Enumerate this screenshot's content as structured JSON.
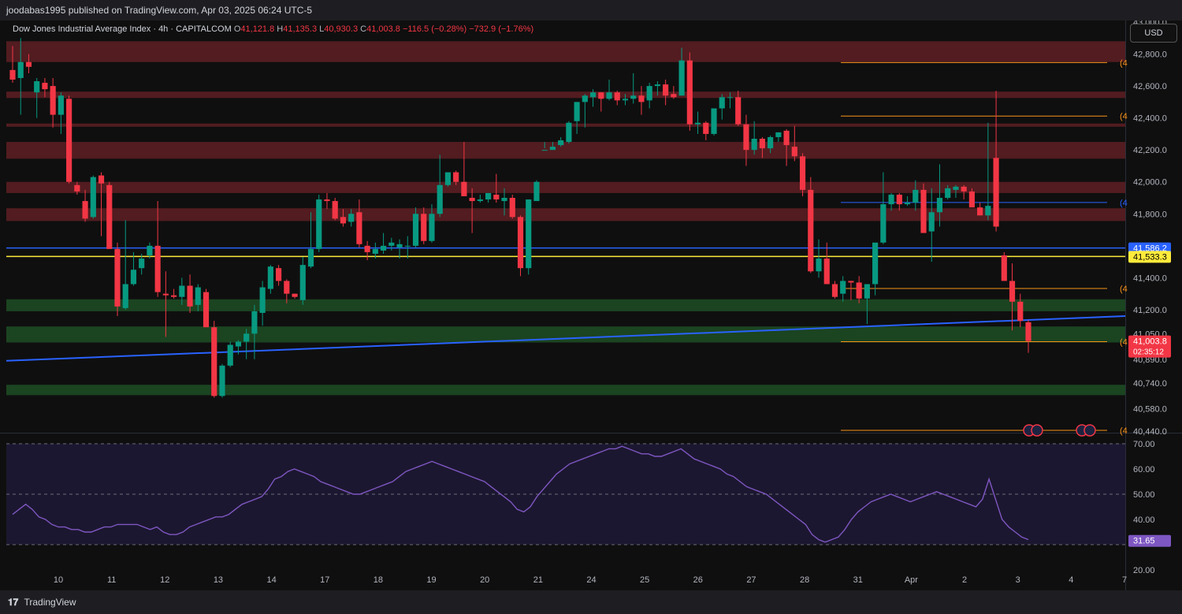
{
  "header": {
    "publisher_text": "joodabas1995 published on TradingView.com, Apr 03, 2025 06:24 UTC-5"
  },
  "footer": {
    "brand": "TradingView"
  },
  "legend": {
    "symbol": "Dow Jones Industrial Average Index · 4h · CAPITALCOM",
    "open_label": "O",
    "open": "41,121.8",
    "high_label": "H",
    "high": "41,135.3",
    "low_label": "L",
    "low": "40,930.3",
    "close_label": "C",
    "close": "41,003.8",
    "change": "−116.5 (−0.28%)",
    "change2": "−732.9 (−1.76%)"
  },
  "currency_button": "USD",
  "colors": {
    "up": "#089981",
    "down": "#f23645",
    "resistance_zone": "#5a1e22",
    "support_zone": "#1d4a24",
    "trendline": "#2962ff",
    "yellow_line": "#ffeb3b",
    "orange_line": "#f7931a",
    "rsi": "#7e57c2"
  },
  "chart_data": [
    {
      "type": "candlestick",
      "title": "Dow Jones Industrial Average Index · 4h · CAPITALCOM",
      "x_tick_labels": [
        "10",
        "11",
        "12",
        "13",
        "14",
        "17",
        "18",
        "19",
        "20",
        "21",
        "24",
        "25",
        "26",
        "27",
        "28",
        "31",
        "Apr",
        "2",
        "3",
        "4",
        "7"
      ],
      "y_tick_labels": [
        "43,000.0",
        "42,800.0",
        "42,600.0",
        "42,400.0",
        "42,200.0",
        "42,000.0",
        "41,800.0",
        "41,400.0",
        "41,200.0",
        "41,050.0",
        "40,890.0",
        "40,740.0",
        "40,580.0",
        "40,440.0"
      ],
      "ylim": [
        40430,
        43010
      ],
      "price_labels": [
        {
          "text": "41,586.2",
          "value": 41586.2,
          "color": "#2962ff"
        },
        {
          "text": "41,533.3",
          "value": 41533.3,
          "color": "#ffeb3b"
        },
        {
          "text": "41,003.8",
          "value": 41003.8,
          "color": "#f23645",
          "countdown": "02:35:12"
        }
      ],
      "horizontal_lines": [
        {
          "value": 41586.2,
          "color": "#2962ff"
        },
        {
          "value": 41533.3,
          "color": "#ffeb3b"
        },
        {
          "value": 42747,
          "color": "#f7931a",
          "label": "(4"
        },
        {
          "value": 42412,
          "color": "#f7931a",
          "label": "(4"
        },
        {
          "value": 41871,
          "color": "#2962ff",
          "label": "(4"
        },
        {
          "value": 41333,
          "color": "#f7931a",
          "label": "(4"
        },
        {
          "value": 41000,
          "color": "#f7931a",
          "label": "(4"
        },
        {
          "value": 40445,
          "color": "#f7931a",
          "label": "(4"
        }
      ],
      "zones": [
        {
          "type": "resistance",
          "from": 42750,
          "to": 42880
        },
        {
          "type": "resistance",
          "from": 42525,
          "to": 42565
        },
        {
          "type": "resistance",
          "from": 42345,
          "to": 42365
        },
        {
          "type": "resistance",
          "from": 42145,
          "to": 42250
        },
        {
          "type": "resistance",
          "from": 41930,
          "to": 42000
        },
        {
          "type": "resistance",
          "from": 41755,
          "to": 41835
        },
        {
          "type": "support",
          "from": 41190,
          "to": 41265
        },
        {
          "type": "support",
          "from": 40995,
          "to": 41095
        },
        {
          "type": "support",
          "from": 40665,
          "to": 40730
        }
      ],
      "trendline": {
        "start": 40880,
        "end": 41160
      },
      "candles": [
        [
          42700,
          42850,
          42620,
          42640
        ],
        [
          42650,
          42900,
          42420,
          42750
        ],
        [
          42750,
          42800,
          42680,
          42720
        ],
        [
          42560,
          42650,
          42400,
          42630
        ],
        [
          42620,
          42650,
          42530,
          42580
        ],
        [
          42600,
          42650,
          42340,
          42420
        ],
        [
          42420,
          42560,
          42300,
          42540
        ],
        [
          42520,
          42540,
          41990,
          42000
        ],
        [
          41980,
          42000,
          41920,
          41940
        ],
        [
          41880,
          41950,
          41750,
          41770
        ],
        [
          41780,
          42040,
          41770,
          42030
        ],
        [
          42040,
          42060,
          41660,
          41990
        ],
        [
          41980,
          42000,
          41580,
          41580
        ],
        [
          41580,
          41620,
          41160,
          41220
        ],
        [
          41210,
          41760,
          41200,
          41360
        ],
        [
          41360,
          41560,
          41350,
          41450
        ],
        [
          41460,
          41550,
          41420,
          41520
        ],
        [
          41540,
          41620,
          41520,
          41600
        ],
        [
          41600,
          41880,
          41280,
          41310
        ],
        [
          41300,
          41440,
          41030,
          41290
        ],
        [
          41290,
          41330,
          41270,
          41280
        ],
        [
          41280,
          41400,
          41230,
          41350
        ],
        [
          41350,
          41420,
          41180,
          41220
        ],
        [
          41230,
          41360,
          41190,
          41340
        ],
        [
          41310,
          41330,
          41090,
          41090
        ],
        [
          41090,
          41130,
          40650,
          40660
        ],
        [
          40660,
          40860,
          40650,
          40850
        ],
        [
          40850,
          41000,
          40840,
          40980
        ],
        [
          40970,
          41010,
          40920,
          41000
        ],
        [
          41000,
          41080,
          40890,
          41050
        ],
        [
          41050,
          41230,
          40890,
          41190
        ],
        [
          41180,
          41380,
          41100,
          41340
        ],
        [
          41330,
          41480,
          41300,
          41470
        ],
        [
          41460,
          41480,
          41350,
          41380
        ],
        [
          41380,
          41390,
          41240,
          41300
        ],
        [
          41300,
          41300,
          41270,
          41280
        ],
        [
          41260,
          41530,
          41230,
          41480
        ],
        [
          41470,
          41810,
          41460,
          41580
        ],
        [
          41580,
          41920,
          41560,
          41890
        ],
        [
          41890,
          41930,
          41830,
          41880
        ],
        [
          41880,
          41900,
          41760,
          41770
        ],
        [
          41780,
          41830,
          41720,
          41740
        ],
        [
          41750,
          41830,
          41720,
          41800
        ],
        [
          41810,
          41890,
          41590,
          41610
        ],
        [
          41600,
          41630,
          41510,
          41560
        ],
        [
          41550,
          41620,
          41520,
          41580
        ],
        [
          41570,
          41680,
          41550,
          41600
        ],
        [
          41600,
          41650,
          41570,
          41620
        ],
        [
          41590,
          41640,
          41520,
          41610
        ],
        [
          41600,
          41660,
          41520,
          41600
        ],
        [
          41600,
          41840,
          41590,
          41800
        ],
        [
          41800,
          41840,
          41610,
          41630
        ],
        [
          41630,
          41860,
          41620,
          41800
        ],
        [
          41800,
          42170,
          41780,
          41980
        ],
        [
          41980,
          42060,
          41970,
          42060
        ],
        [
          42060,
          42070,
          41980,
          42000
        ],
        [
          42000,
          42250,
          41930,
          41910
        ],
        [
          41900,
          41960,
          41680,
          41880
        ],
        [
          41880,
          41920,
          41870,
          41890
        ],
        [
          41890,
          41930,
          41870,
          41930
        ],
        [
          41920,
          42050,
          41870,
          41890
        ],
        [
          41880,
          41960,
          41790,
          41900
        ],
        [
          41900,
          41920,
          41770,
          41780
        ],
        [
          41780,
          41790,
          41410,
          41460
        ],
        [
          41460,
          41890,
          41420,
          41890
        ],
        [
          41880,
          42010,
          41890,
          42000
        ],
        [
          42200,
          42250,
          42210,
          42200
        ],
        [
          42200,
          42250,
          42200,
          42220
        ],
        [
          42230,
          42280,
          42220,
          42260
        ],
        [
          42250,
          42380,
          42240,
          42370
        ],
        [
          42380,
          42500,
          42300,
          42500
        ],
        [
          42500,
          42550,
          42340,
          42540
        ],
        [
          42530,
          42580,
          42470,
          42560
        ],
        [
          42560,
          42560,
          42440,
          42520
        ],
        [
          42520,
          42640,
          42510,
          42560
        ],
        [
          42560,
          42570,
          42480,
          42510
        ],
        [
          42510,
          42550,
          42480,
          42520
        ],
        [
          42520,
          42680,
          42490,
          42540
        ],
        [
          42540,
          42600,
          42420,
          42500
        ],
        [
          42510,
          42620,
          42460,
          42600
        ],
        [
          42600,
          42630,
          42540,
          42610
        ],
        [
          42610,
          42640,
          42480,
          42540
        ],
        [
          42550,
          42600,
          42520,
          42530
        ],
        [
          42540,
          42840,
          42540,
          42760
        ],
        [
          42760,
          42810,
          42320,
          42360
        ],
        [
          42360,
          42440,
          42300,
          42370
        ],
        [
          42370,
          42380,
          42260,
          42300
        ],
        [
          42300,
          42460,
          42290,
          42460
        ],
        [
          42460,
          42550,
          42390,
          42530
        ],
        [
          42530,
          42560,
          42460,
          42530
        ],
        [
          42530,
          42570,
          42350,
          42360
        ],
        [
          42360,
          42420,
          42100,
          42200
        ],
        [
          42200,
          42380,
          42170,
          42270
        ],
        [
          42270,
          42280,
          42150,
          42210
        ],
        [
          42210,
          42290,
          42180,
          42280
        ],
        [
          42280,
          42310,
          42250,
          42310
        ],
        [
          42320,
          42330,
          42100,
          42230
        ],
        [
          42220,
          42350,
          42130,
          42160
        ],
        [
          42160,
          42180,
          41910,
          41950
        ],
        [
          41950,
          42030,
          41430,
          41440
        ],
        [
          41440,
          41640,
          41400,
          41520
        ],
        [
          41520,
          41620,
          41370,
          41360
        ],
        [
          41360,
          41380,
          41270,
          41280
        ],
        [
          41300,
          41410,
          41250,
          41380
        ],
        [
          41380,
          41380,
          41260,
          41370
        ],
        [
          41370,
          41410,
          41240,
          41270
        ],
        [
          41270,
          41300,
          41110,
          41360
        ],
        [
          41360,
          41440,
          41290,
          41620
        ],
        [
          41620,
          42060,
          41610,
          41860
        ],
        [
          41860,
          41930,
          41820,
          41920
        ],
        [
          41920,
          41930,
          41820,
          41860
        ],
        [
          41860,
          41910,
          41850,
          41870
        ],
        [
          41870,
          42010,
          41820,
          41950
        ],
        [
          41950,
          41990,
          41690,
          41680
        ],
        [
          41690,
          41960,
          41500,
          41810
        ],
        [
          41810,
          42110,
          41720,
          41900
        ],
        [
          41900,
          41980,
          41890,
          41960
        ],
        [
          41950,
          41980,
          41900,
          41970
        ],
        [
          41970,
          41980,
          41890,
          41940
        ],
        [
          41940,
          41960,
          41850,
          41840
        ],
        [
          41840,
          41870,
          41800,
          41790
        ],
        [
          41790,
          42370,
          41760,
          41850
        ],
        [
          42150,
          42570,
          41690,
          41720
        ],
        [
          41540,
          41560,
          41380,
          41380
        ],
        [
          41380,
          41490,
          41070,
          41250
        ],
        [
          41250,
          41300,
          41090,
          41130
        ],
        [
          41121.8,
          41135.3,
          40930.3,
          41003.8
        ]
      ],
      "rsi": {
        "ylim": [
          20,
          70
        ],
        "y_tick_labels": [
          "70.00",
          "60.00",
          "50.00",
          "40.00",
          "20.00"
        ],
        "bands": [
          70,
          50,
          30
        ],
        "current_label": "31.65",
        "values": [
          42,
          44,
          46,
          44,
          41,
          40,
          38,
          37,
          37,
          36,
          36,
          35,
          35,
          36,
          37,
          37,
          38,
          38,
          38,
          38,
          37,
          36,
          37,
          35,
          34,
          34,
          35,
          37,
          38,
          39,
          40,
          41,
          41,
          42,
          44,
          46,
          47,
          48,
          49,
          52,
          56,
          57,
          59,
          60,
          59,
          58,
          57,
          55,
          54,
          53,
          52,
          51,
          50,
          50,
          51,
          52,
          53,
          54,
          55,
          57,
          59,
          60,
          61,
          62,
          63,
          62,
          61,
          60,
          59,
          58,
          57,
          56,
          55,
          53,
          51,
          49,
          47,
          44,
          43,
          45,
          49,
          52,
          55,
          58,
          60,
          62,
          63,
          64,
          65,
          66,
          67,
          68,
          68,
          69,
          68,
          67,
          66,
          66,
          65,
          65,
          66,
          67,
          68,
          66,
          64,
          63,
          62,
          61,
          60,
          58,
          57,
          55,
          53,
          52,
          51,
          50,
          48,
          46,
          44,
          42,
          40,
          38,
          34,
          32,
          31,
          32,
          33,
          36,
          40,
          43,
          45,
          47,
          48,
          49,
          50,
          49,
          48,
          47,
          48,
          49,
          50,
          51,
          50,
          49,
          48,
          47,
          46,
          45,
          48,
          56,
          48,
          40,
          37,
          35,
          33,
          32
        ]
      }
    }
  ]
}
